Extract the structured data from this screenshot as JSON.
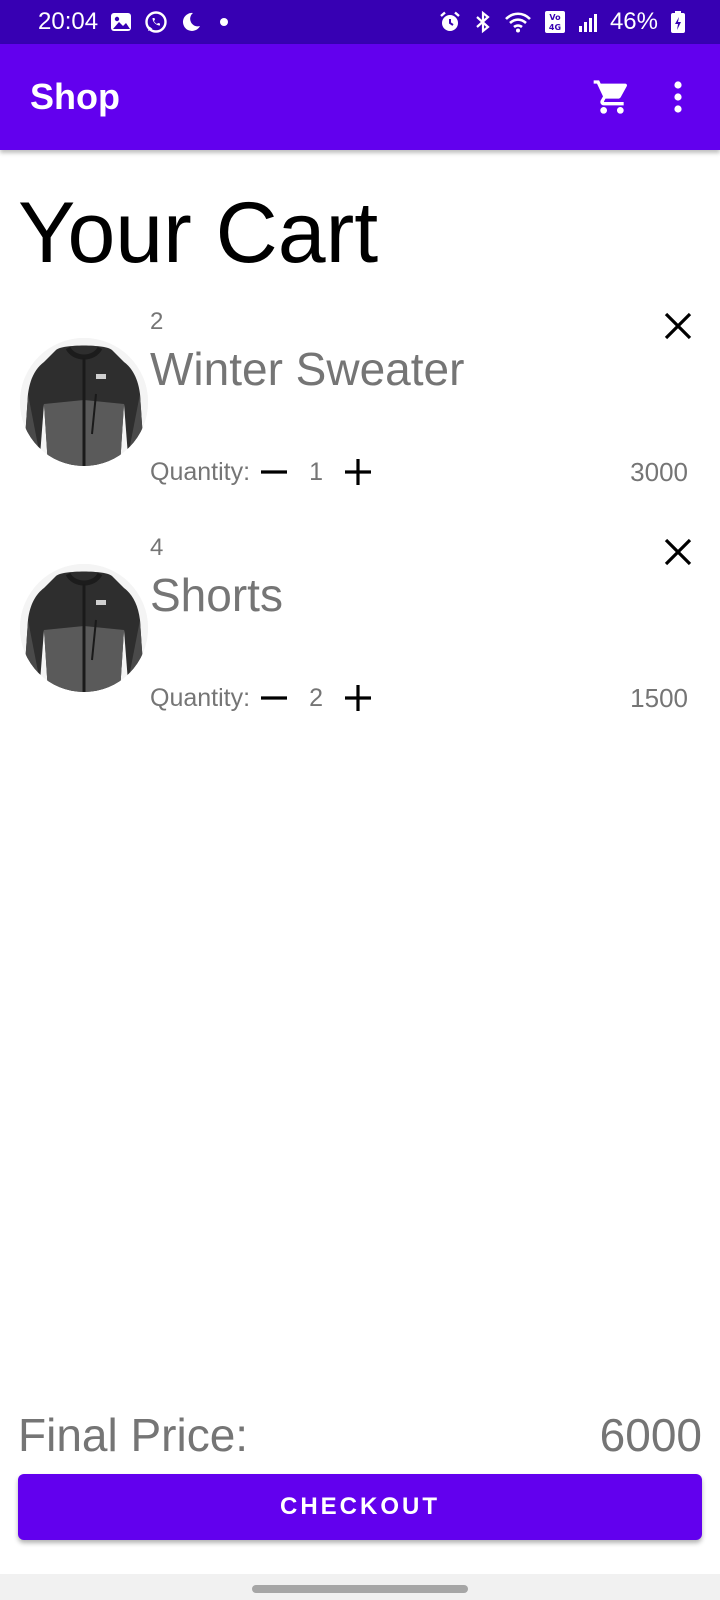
{
  "status_bar": {
    "time": "20:04",
    "battery": "46%",
    "icons": [
      "gallery-icon",
      "whatsapp-icon",
      "moon-icon",
      "dot-icon",
      "alarm-icon",
      "bluetooth-icon",
      "wifi-icon",
      "volte-4g-icon",
      "signal-icon",
      "battery-icon"
    ]
  },
  "app_bar": {
    "title": "Shop",
    "actions": [
      "cart-icon",
      "overflow-menu-icon"
    ]
  },
  "page": {
    "title": "Your Cart"
  },
  "cart_items": [
    {
      "id": "2",
      "name": "Winter Sweater",
      "quantity_label": "Quantity:",
      "quantity": "1",
      "price": "3000",
      "image": "jacket-image"
    },
    {
      "id": "4",
      "name": "Shorts",
      "quantity_label": "Quantity:",
      "quantity": "2",
      "price": "1500",
      "image": "jacket-image"
    }
  ],
  "summary": {
    "final_price_label": "Final Price:",
    "final_price": "6000"
  },
  "checkout": {
    "label": "CHECKOUT"
  },
  "colors": {
    "primary": "#6200ee",
    "primary_dark": "#3700b3",
    "text_secondary": "#757575"
  }
}
